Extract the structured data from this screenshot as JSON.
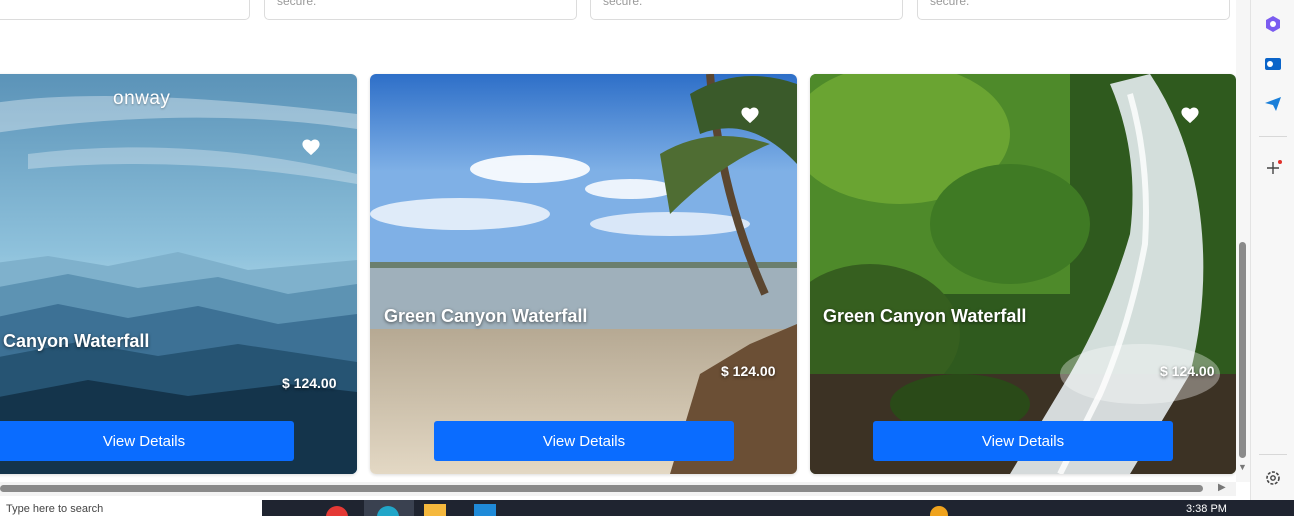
{
  "fields": [
    {
      "placeholder": "secure."
    },
    {
      "placeholder": "secure."
    },
    {
      "placeholder": "secure."
    }
  ],
  "cards": [
    {
      "brand": "onway",
      "title": "Canyon Waterfall",
      "price": "$ 124.00",
      "button": "View Details"
    },
    {
      "title": "Green Canyon Waterfall",
      "price": "$ 124.00",
      "button": "View Details"
    },
    {
      "title": "Green Canyon Waterfall",
      "price": "$ 124.00",
      "button": "View Details"
    }
  ],
  "taskbar": {
    "search_placeholder": "Type here to search",
    "time": "3:38 PM"
  },
  "sidebar": {
    "icons": [
      "copilot-icon",
      "outlook-icon",
      "send-icon",
      "add-icon",
      "settings-icon"
    ]
  },
  "colors": {
    "button": "#0a6cff",
    "card_text": "#ffffff"
  }
}
